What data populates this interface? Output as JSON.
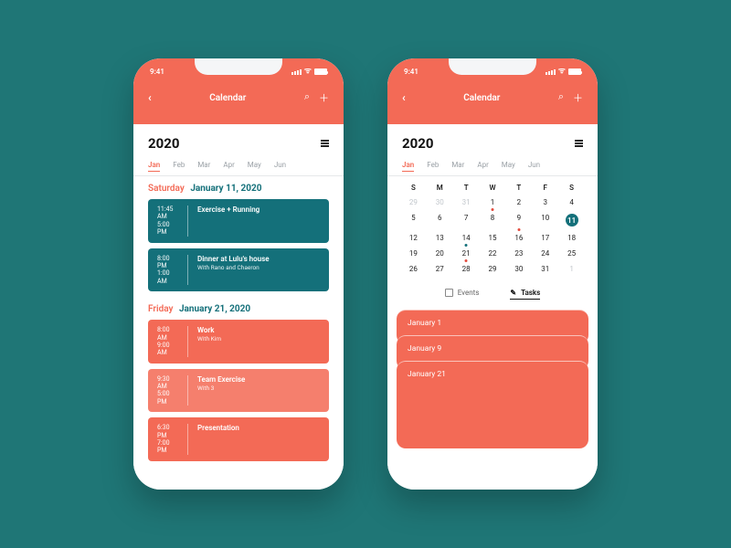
{
  "status": {
    "time": "9:41"
  },
  "nav": {
    "title": "Calendar"
  },
  "year": "2020",
  "months": [
    "Jan",
    "Feb",
    "Mar",
    "Apr",
    "May",
    "Jun"
  ],
  "active_month_index": 0,
  "left": {
    "days": [
      {
        "dow": "Saturday",
        "date": "January 11, 2020",
        "events": [
          {
            "style": "teal",
            "start": "11:45 AM",
            "end": "5:00 PM",
            "title": "Exercise + Running",
            "sub": ""
          },
          {
            "style": "teal",
            "start": "8:00 PM",
            "end": "1:00 AM",
            "title": "Dinner at Lulu's house",
            "sub": "With Rano and Chaeron"
          }
        ]
      },
      {
        "dow": "Friday",
        "date": "January 21, 2020",
        "events": [
          {
            "style": "coral",
            "start": "8:00 AM",
            "end": "9:00 AM",
            "title": "Work",
            "sub": "With Kim"
          },
          {
            "style": "coral2",
            "start": "9:30 AM",
            "end": "5:00 PM",
            "title": "Team Exercise",
            "sub": "With 3"
          },
          {
            "style": "coral",
            "start": "6:30 PM",
            "end": "7:00 PM",
            "title": "Presentation",
            "sub": ""
          }
        ]
      }
    ]
  },
  "right": {
    "dow": [
      "S",
      "M",
      "T",
      "W",
      "T",
      "F",
      "S"
    ],
    "weeks": [
      [
        {
          "n": 29,
          "dim": true
        },
        {
          "n": 30,
          "dim": true
        },
        {
          "n": 31,
          "dim": true
        },
        {
          "n": 1,
          "dot": "red"
        },
        {
          "n": 2
        },
        {
          "n": 3
        },
        {
          "n": 4
        }
      ],
      [
        {
          "n": 5
        },
        {
          "n": 6
        },
        {
          "n": 7
        },
        {
          "n": 8
        },
        {
          "n": 9,
          "dot": "red"
        },
        {
          "n": 10
        },
        {
          "n": 11,
          "selected": true
        }
      ],
      [
        {
          "n": 12
        },
        {
          "n": 13
        },
        {
          "n": 14,
          "dot": "teal"
        },
        {
          "n": 15
        },
        {
          "n": 16
        },
        {
          "n": 17
        },
        {
          "n": 18
        }
      ],
      [
        {
          "n": 19
        },
        {
          "n": 20
        },
        {
          "n": 21,
          "dot": "red"
        },
        {
          "n": 22
        },
        {
          "n": 23
        },
        {
          "n": 24
        },
        {
          "n": 25
        }
      ],
      [
        {
          "n": 26
        },
        {
          "n": 27
        },
        {
          "n": 28
        },
        {
          "n": 29
        },
        {
          "n": 30
        },
        {
          "n": 31
        },
        {
          "n": 1,
          "dim": true
        }
      ]
    ],
    "tabs": {
      "events": "Events",
      "tasks": "Tasks",
      "active": "tasks"
    },
    "tasks": [
      {
        "label": "January 1"
      },
      {
        "label": "January 9"
      },
      {
        "label": "January 21"
      }
    ]
  }
}
